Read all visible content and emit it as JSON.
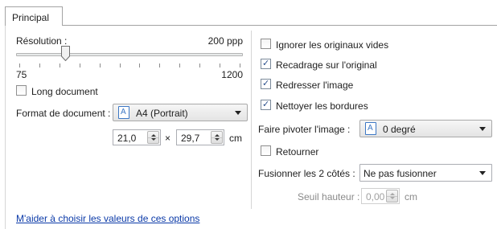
{
  "tabs": [
    {
      "label": "Principal"
    }
  ],
  "resolution": {
    "label": "Résolution :",
    "value_display": "200 ppp",
    "min_label": "75",
    "max_label": "1200",
    "min": 75,
    "max": 1200,
    "value": 200
  },
  "long_document": {
    "label": "Long document",
    "checked": false
  },
  "document_format": {
    "label": "Format de document :",
    "selected": "A4 (Portrait)",
    "icon": "document-a-icon",
    "width": "21,0",
    "height": "29,7",
    "times": "×",
    "unit": "cm"
  },
  "options": [
    {
      "label": "Ignorer les originaux vides",
      "checked": false
    },
    {
      "label": "Recadrage sur l'original",
      "checked": true
    },
    {
      "label": "Redresser l'image",
      "checked": true
    },
    {
      "label": "Nettoyer les bordures",
      "checked": true
    }
  ],
  "rotate": {
    "label": "Faire pivoter l'image :",
    "selected": "0 degré",
    "icon": "document-a-icon"
  },
  "flip": {
    "label": "Retourner",
    "checked": false
  },
  "merge": {
    "label": "Fusionner les 2 côtés :",
    "selected": "Ne pas fusionner"
  },
  "height_threshold": {
    "label": "Seuil hauteur :",
    "value": "0,00",
    "unit": "cm",
    "enabled": false
  },
  "help_link": "M'aider à choisir les valeurs de ces options",
  "colors": {
    "link": "#0b3aa8",
    "check": "#2a4f8c",
    "accent": "#3c77c4"
  }
}
